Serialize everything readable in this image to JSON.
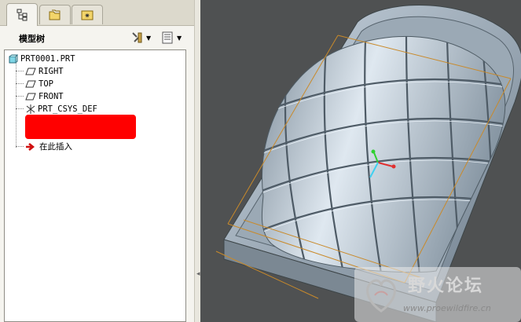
{
  "tabs": [
    {
      "icon": "model-tree-icon",
      "active": true
    },
    {
      "icon": "folder-browser-icon",
      "active": false
    },
    {
      "icon": "favorites-icon",
      "active": false
    }
  ],
  "panel": {
    "title": "模型树",
    "settings_icon": "settings-tools-icon",
    "show_icon": "show-list-icon"
  },
  "tree": {
    "root": "PRT0001.PRT",
    "items": [
      "RIGHT",
      "TOP",
      "FRONT",
      "PRT_CSYS_DEF"
    ],
    "insert_here": "在此插入"
  },
  "watermark": {
    "title": "野火论坛",
    "url": "www.proewildfire.cn"
  },
  "colors": {
    "viewport_bg": "#4f5152",
    "redacted": "#ff0000",
    "model": "#b9c6d2",
    "edge_lines": "#c98a2a"
  }
}
